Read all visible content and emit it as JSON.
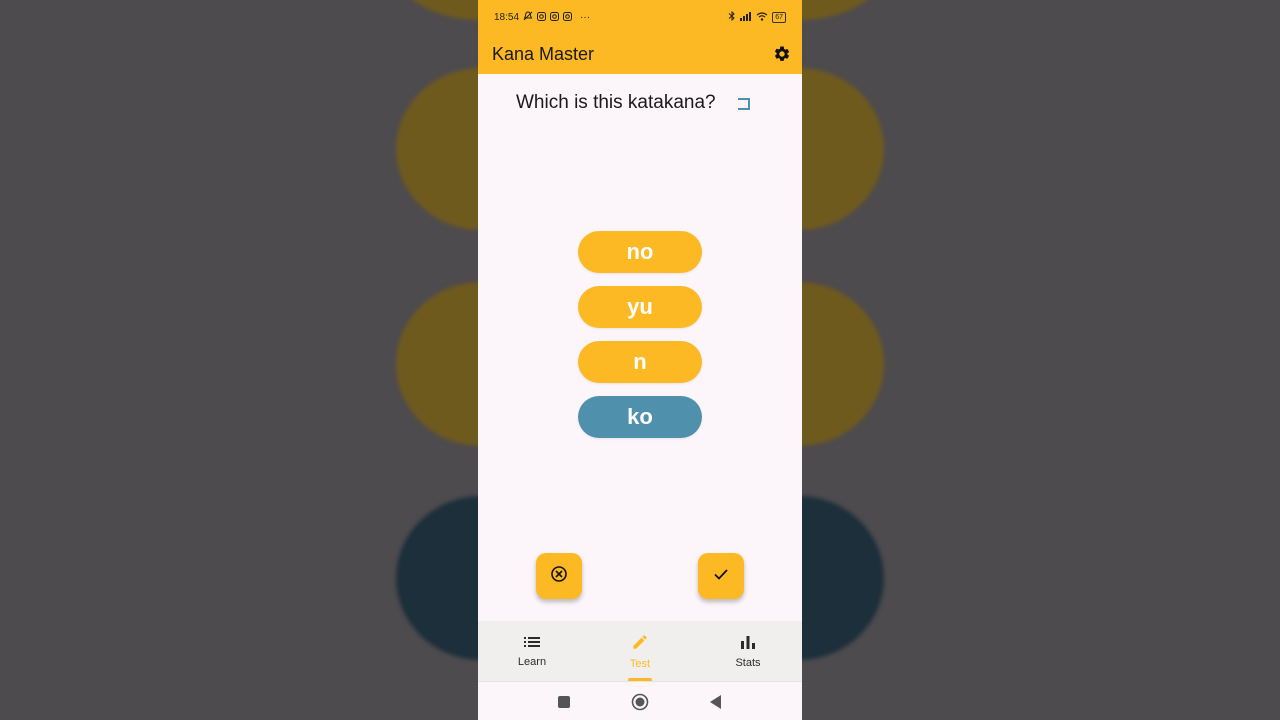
{
  "status_bar": {
    "time": "18:54",
    "more": "···",
    "battery": "67"
  },
  "app_bar": {
    "title": "Kana Master"
  },
  "question": {
    "text": "Which is this katakana?",
    "kana": "コ"
  },
  "options": [
    {
      "label": "no",
      "selected": false
    },
    {
      "label": "yu",
      "selected": false
    },
    {
      "label": "n",
      "selected": false
    },
    {
      "label": "ko",
      "selected": true
    }
  ],
  "bottom_nav": {
    "items": [
      {
        "label": "Learn",
        "icon": "list-icon",
        "active": false
      },
      {
        "label": "Test",
        "icon": "pencil-icon",
        "active": true
      },
      {
        "label": "Stats",
        "icon": "bar-chart-icon",
        "active": false
      }
    ]
  },
  "colors": {
    "accent": "#fdb924",
    "selected": "#4f91ad",
    "background": "#fcf6fb"
  }
}
